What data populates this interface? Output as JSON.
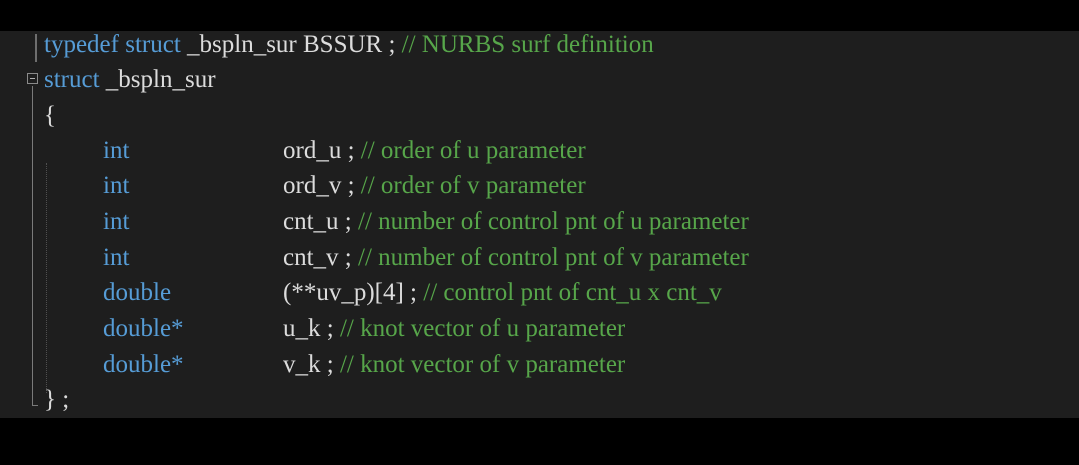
{
  "lines": {
    "typedef": {
      "kw_typedef": "typedef",
      "kw_struct": "struct",
      "name": "_bspln_sur BSSUR ;",
      "comment": "// NURBS surf definition"
    },
    "struct_header": {
      "kw_struct": "struct",
      "name": "_bspln_sur"
    },
    "open_brace": "{",
    "fields": [
      {
        "type": "int",
        "decl": "ord_u ;",
        "comment": "// order of u parameter"
      },
      {
        "type": "int",
        "decl": "ord_v ;",
        "comment": "// order of v parameter"
      },
      {
        "type": "int",
        "decl": "cnt_u ;",
        "comment": "// number of control pnt of u parameter"
      },
      {
        "type": "int",
        "decl": "cnt_v ;",
        "comment": "// number of control pnt of v parameter"
      },
      {
        "type": "double",
        "decl": "(**uv_p)[4] ;",
        "comment": "// control pnt of cnt_u x cnt_v"
      },
      {
        "type": "double*",
        "decl": "u_k ;",
        "comment": "// knot vector of u parameter"
      },
      {
        "type": "double*",
        "decl": "v_k ;",
        "comment": "// knot vector of v parameter"
      }
    ],
    "close_brace": "} ;"
  },
  "colors": {
    "background": "#1e1e1e",
    "keyword": "#569cd6",
    "comment": "#57a64a",
    "text": "#dcdcdc"
  },
  "icons": {
    "fold": "collapse-minus-icon"
  }
}
